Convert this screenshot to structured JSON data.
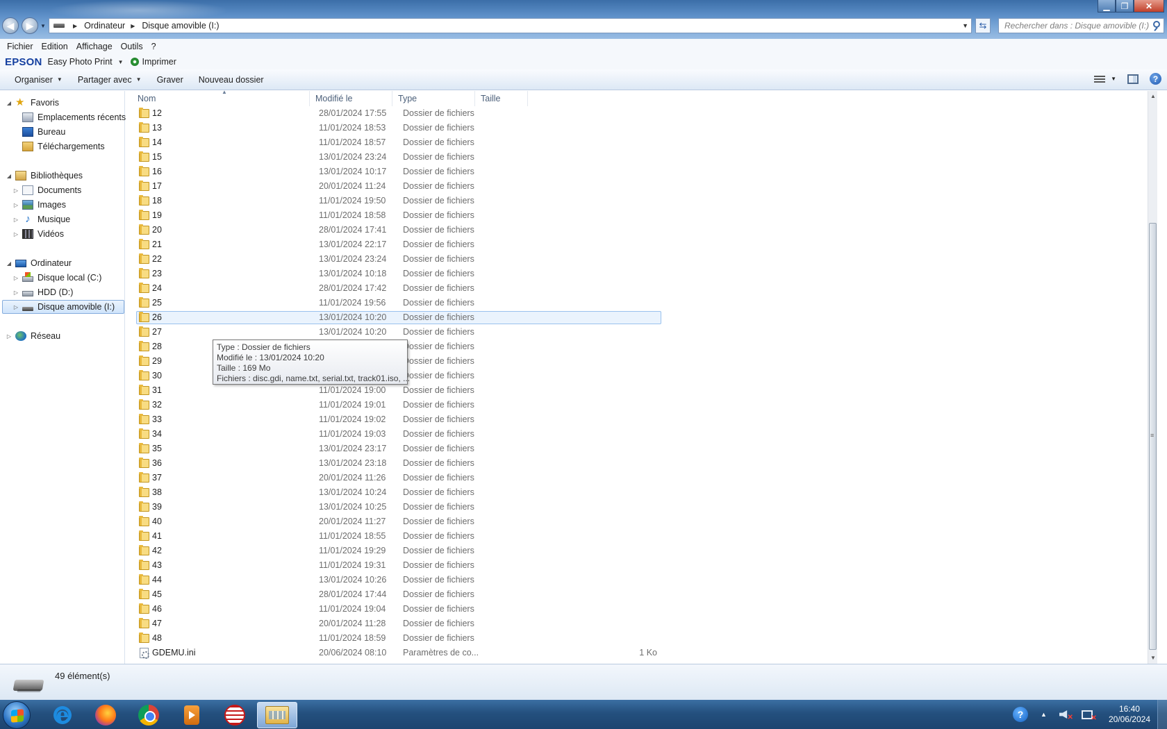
{
  "window": {
    "controls": {
      "minimize": "▁",
      "maximize": "❐",
      "close": "✕"
    }
  },
  "address": {
    "crumbs": [
      "Ordinateur",
      "Disque amovible (I:)"
    ],
    "search_placeholder": "Rechercher dans : Disque amovible (I:)"
  },
  "menubar": {
    "items": [
      "Fichier",
      "Edition",
      "Affichage",
      "Outils",
      "?"
    ]
  },
  "epson": {
    "logo": "EPSON",
    "app": "Easy Photo Print",
    "print": "Imprimer"
  },
  "commands": {
    "organize": "Organiser",
    "share": "Partager avec",
    "burn": "Graver",
    "new_folder": "Nouveau dossier"
  },
  "nav": {
    "favorites": "Favoris",
    "recent": "Emplacements récents",
    "desktop": "Bureau",
    "downloads": "Téléchargements",
    "libraries": "Bibliothèques",
    "documents": "Documents",
    "images": "Images",
    "music": "Musique",
    "videos": "Vidéos",
    "computer": "Ordinateur",
    "local_disk": "Disque local (C:)",
    "hdd": "HDD (D:)",
    "removable": "Disque amovible (I:)",
    "network": "Réseau"
  },
  "columns": {
    "name": "Nom",
    "modified": "Modifié le",
    "type": "Type",
    "size": "Taille"
  },
  "files": [
    {
      "name": "12",
      "date": "28/01/2024 17:55",
      "type": "Dossier de fichiers",
      "size": ""
    },
    {
      "name": "13",
      "date": "11/01/2024 18:53",
      "type": "Dossier de fichiers",
      "size": ""
    },
    {
      "name": "14",
      "date": "11/01/2024 18:57",
      "type": "Dossier de fichiers",
      "size": ""
    },
    {
      "name": "15",
      "date": "13/01/2024 23:24",
      "type": "Dossier de fichiers",
      "size": ""
    },
    {
      "name": "16",
      "date": "13/01/2024 10:17",
      "type": "Dossier de fichiers",
      "size": ""
    },
    {
      "name": "17",
      "date": "20/01/2024 11:24",
      "type": "Dossier de fichiers",
      "size": ""
    },
    {
      "name": "18",
      "date": "11/01/2024 19:50",
      "type": "Dossier de fichiers",
      "size": ""
    },
    {
      "name": "19",
      "date": "11/01/2024 18:58",
      "type": "Dossier de fichiers",
      "size": ""
    },
    {
      "name": "20",
      "date": "28/01/2024 17:41",
      "type": "Dossier de fichiers",
      "size": ""
    },
    {
      "name": "21",
      "date": "13/01/2024 22:17",
      "type": "Dossier de fichiers",
      "size": ""
    },
    {
      "name": "22",
      "date": "13/01/2024 23:24",
      "type": "Dossier de fichiers",
      "size": ""
    },
    {
      "name": "23",
      "date": "13/01/2024 10:18",
      "type": "Dossier de fichiers",
      "size": ""
    },
    {
      "name": "24",
      "date": "28/01/2024 17:42",
      "type": "Dossier de fichiers",
      "size": ""
    },
    {
      "name": "25",
      "date": "11/01/2024 19:56",
      "type": "Dossier de fichiers",
      "size": ""
    },
    {
      "name": "26",
      "date": "13/01/2024 10:20",
      "type": "Dossier de fichiers",
      "size": "",
      "selected": true
    },
    {
      "name": "27",
      "date": "13/01/2024 10:20",
      "type": "Dossier de fichiers",
      "size": ""
    },
    {
      "name": "28",
      "date": "",
      "type": "Dossier de fichiers",
      "size": ""
    },
    {
      "name": "29",
      "date": "",
      "type": "Dossier de fichiers",
      "size": ""
    },
    {
      "name": "30",
      "date": "",
      "type": "Dossier de fichiers",
      "size": ""
    },
    {
      "name": "31",
      "date": "11/01/2024 19:00",
      "type": "Dossier de fichiers",
      "size": ""
    },
    {
      "name": "32",
      "date": "11/01/2024 19:01",
      "type": "Dossier de fichiers",
      "size": ""
    },
    {
      "name": "33",
      "date": "11/01/2024 19:02",
      "type": "Dossier de fichiers",
      "size": ""
    },
    {
      "name": "34",
      "date": "11/01/2024 19:03",
      "type": "Dossier de fichiers",
      "size": ""
    },
    {
      "name": "35",
      "date": "13/01/2024 23:17",
      "type": "Dossier de fichiers",
      "size": ""
    },
    {
      "name": "36",
      "date": "13/01/2024 23:18",
      "type": "Dossier de fichiers",
      "size": ""
    },
    {
      "name": "37",
      "date": "20/01/2024 11:26",
      "type": "Dossier de fichiers",
      "size": ""
    },
    {
      "name": "38",
      "date": "13/01/2024 10:24",
      "type": "Dossier de fichiers",
      "size": ""
    },
    {
      "name": "39",
      "date": "13/01/2024 10:25",
      "type": "Dossier de fichiers",
      "size": ""
    },
    {
      "name": "40",
      "date": "20/01/2024 11:27",
      "type": "Dossier de fichiers",
      "size": ""
    },
    {
      "name": "41",
      "date": "11/01/2024 18:55",
      "type": "Dossier de fichiers",
      "size": ""
    },
    {
      "name": "42",
      "date": "11/01/2024 19:29",
      "type": "Dossier de fichiers",
      "size": ""
    },
    {
      "name": "43",
      "date": "11/01/2024 19:31",
      "type": "Dossier de fichiers",
      "size": ""
    },
    {
      "name": "44",
      "date": "13/01/2024 10:26",
      "type": "Dossier de fichiers",
      "size": ""
    },
    {
      "name": "45",
      "date": "28/01/2024 17:44",
      "type": "Dossier de fichiers",
      "size": ""
    },
    {
      "name": "46",
      "date": "11/01/2024 19:04",
      "type": "Dossier de fichiers",
      "size": ""
    },
    {
      "name": "47",
      "date": "20/01/2024 11:28",
      "type": "Dossier de fichiers",
      "size": ""
    },
    {
      "name": "48",
      "date": "11/01/2024 18:59",
      "type": "Dossier de fichiers",
      "size": ""
    },
    {
      "name": "GDEMU.ini",
      "date": "20/06/2024 08:10",
      "type": "Paramètres de co...",
      "size": "1 Ko",
      "kind": "ini"
    }
  ],
  "tooltip": {
    "line1": "Type : Dossier de fichiers",
    "line2": "Modifié le : 13/01/2024 10:20",
    "line3": "Taille : 169 Mo",
    "line4": "Fichiers : disc.gdi, name.txt, serial.txt, track01.iso, ..."
  },
  "status": {
    "count": "49 élément(s)"
  },
  "taskbar": {
    "ie_glyph": "e",
    "tray_help": "?",
    "tray_arrow": "▲",
    "time": "16:40",
    "date": "20/06/2024"
  },
  "colors": {
    "selection_fill": "#eaf3fd",
    "selection_border": "#99c1ee",
    "epson_blue": "#1540a0",
    "taskbar": "#24507e"
  }
}
